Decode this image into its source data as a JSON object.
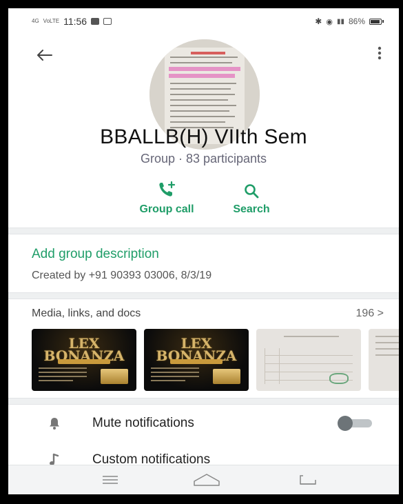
{
  "status_bar": {
    "time": "11:56",
    "battery": "86%",
    "network_left": "4G",
    "network_right": "VoLTE"
  },
  "header": {
    "back_icon": "arrow-left-icon",
    "menu_icon": "more-vert-icon"
  },
  "group": {
    "name": "BBALLB(H) VIIth Sem",
    "subtitle": "Group · 83 participants"
  },
  "actions": [
    {
      "label": "Group call",
      "icon": "add-call-icon"
    },
    {
      "label": "Search",
      "icon": "search-icon"
    }
  ],
  "description": {
    "add_label": "Add group description",
    "created_text": "Created by +91 90393 03006, 8/3/19"
  },
  "media": {
    "title": "Media, links, and docs",
    "count": "196 >",
    "thumbnails": [
      {
        "kind": "poster",
        "text": "LEX BONANZA"
      },
      {
        "kind": "poster",
        "text": "LEX BONANZA"
      },
      {
        "kind": "document"
      },
      {
        "kind": "document"
      }
    ]
  },
  "settings": [
    {
      "label": "Mute notifications",
      "icon": "bell-icon",
      "toggle": false
    },
    {
      "label": "Custom notifications",
      "icon": "music-note-icon"
    }
  ],
  "nav": {
    "buttons": [
      "menu-icon",
      "home-icon",
      "back-icon"
    ]
  },
  "colors": {
    "accent": "#1f9d68",
    "text_primary": "#111111",
    "text_secondary": "#667777",
    "divider": "#eef0f1"
  }
}
